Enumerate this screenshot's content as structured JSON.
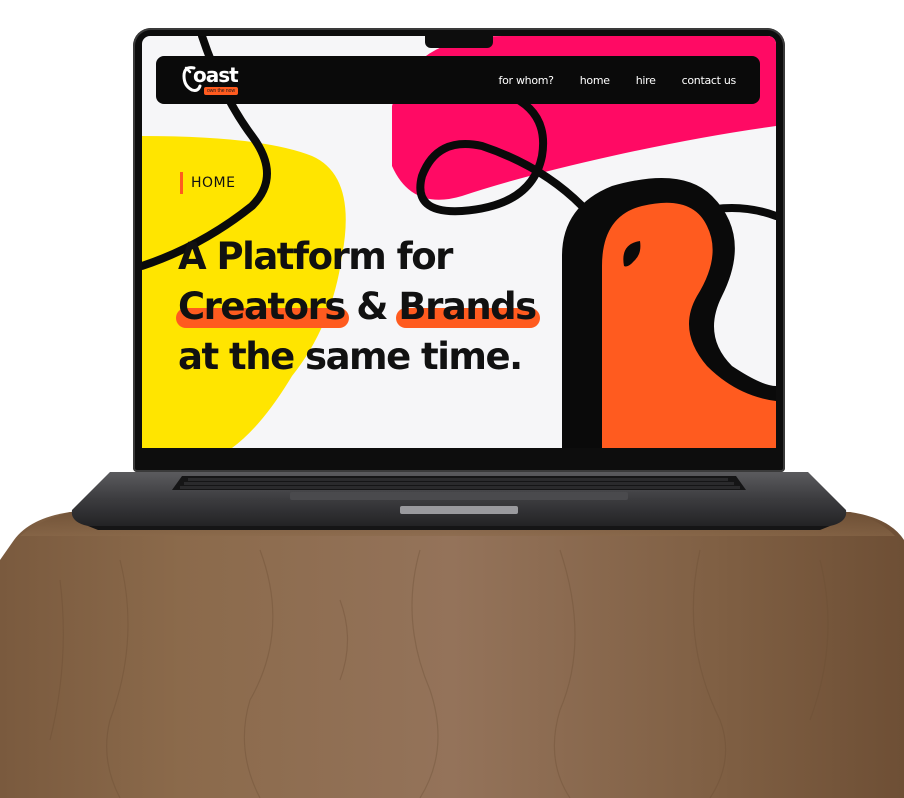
{
  "logo": {
    "name": "oast",
    "tagline": "own the now"
  },
  "nav": {
    "items": [
      "for whom?",
      "home",
      "hire",
      "contact us"
    ]
  },
  "breadcrumb": {
    "label": "HOME"
  },
  "hero": {
    "line1": "A Platform for",
    "highlight1": "Creators",
    "connector": "&",
    "highlight2": "Brands",
    "line3": "at the same time."
  },
  "colors": {
    "accent": "#ff5b1f",
    "pink": "#ff0a64",
    "yellow": "#ffe500",
    "navbar": "#0a0a0a",
    "background": "#f6f6f8"
  }
}
